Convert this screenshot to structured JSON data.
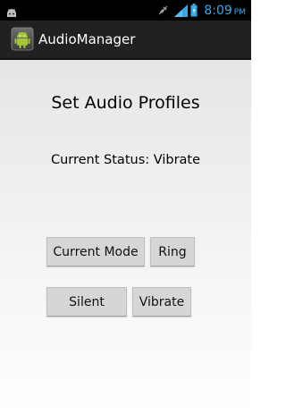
{
  "status_bar": {
    "time": "8:09",
    "ampm": "PM",
    "icons": [
      "android-notification-icon",
      "mute-icon",
      "signal-icon",
      "battery-charging-icon"
    ]
  },
  "action_bar": {
    "app_icon": "android-app-icon",
    "title": "AudioManager"
  },
  "main": {
    "heading": "Set Audio Profiles",
    "status": "Current Status: Vibrate",
    "buttons": {
      "current_mode": "Current Mode",
      "ring": "Ring",
      "silent": "Silent",
      "vibrate": "Vibrate"
    }
  },
  "colors": {
    "clock": "#37a9e6",
    "signal": "#37a9e6",
    "action_bar": "#212121",
    "button": "#d6d6d6"
  }
}
